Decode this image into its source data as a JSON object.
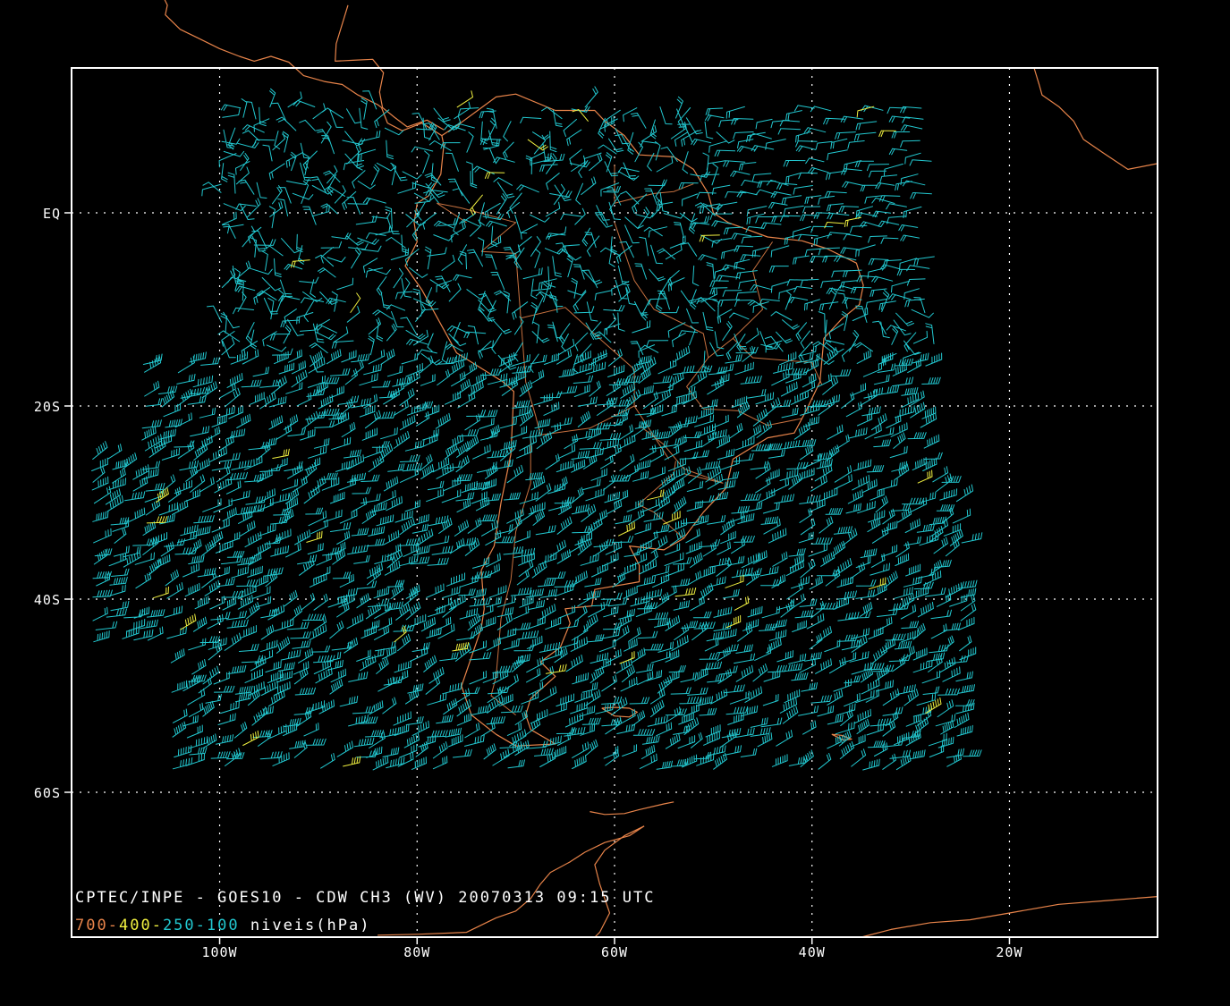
{
  "map": {
    "lon_range": [
      -115,
      -5
    ],
    "lat_range": [
      -75,
      15
    ],
    "colors": {
      "background": "#000000",
      "frame": "#ffffff",
      "grid": "#ffffff",
      "coastline": "#e8844a",
      "wind_cyan": "#22c8d0",
      "wind_yellow": "#f0f040",
      "level_700": "#e8844a",
      "level_400": "#f0f040",
      "level_250": "#22c8d0",
      "level_100": "#22c8d0"
    },
    "lat_ticks": [
      {
        "value": 0,
        "label": "EQ"
      },
      {
        "value": -20,
        "label": "20S"
      },
      {
        "value": -40,
        "label": "40S"
      },
      {
        "value": -60,
        "label": "60S"
      }
    ],
    "lon_ticks": [
      {
        "value": -100,
        "label": "100W"
      },
      {
        "value": -80,
        "label": "80W"
      },
      {
        "value": -60,
        "label": "60W"
      },
      {
        "value": -40,
        "label": "40W"
      },
      {
        "value": -20,
        "label": "20W"
      }
    ]
  },
  "caption": {
    "line1": "CPTEC/INPE - GOES10 - CDW CH3 (WV) 20070313 09:15 UTC",
    "levels": [
      {
        "text": "700",
        "color_key": "level_700"
      },
      {
        "text": "-",
        "color_key": "level_700"
      },
      {
        "text": "400",
        "color_key": "level_400"
      },
      {
        "text": "-",
        "color_key": "level_400"
      },
      {
        "text": "250",
        "color_key": "level_250"
      },
      {
        "text": "-",
        "color_key": "level_250"
      },
      {
        "text": "100",
        "color_key": "level_100"
      }
    ],
    "levels_suffix": " niveis(hPa)"
  }
}
